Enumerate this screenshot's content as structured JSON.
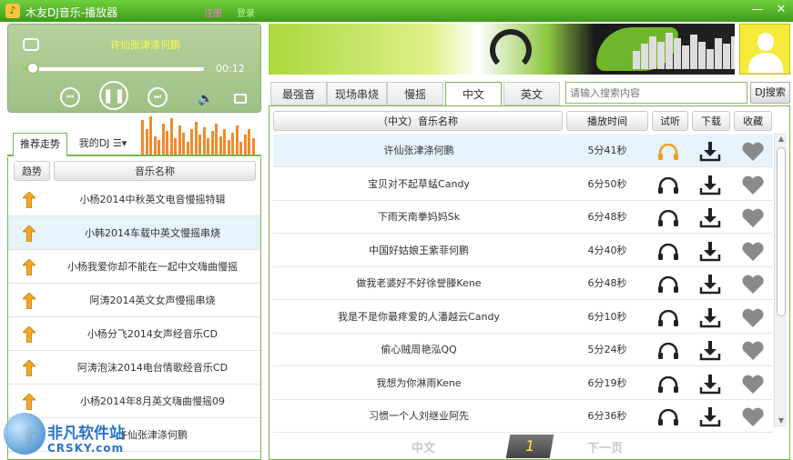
{
  "window": {
    "title": "木友DJ音乐-播放器",
    "register_link": "注册",
    "login_link": "登录",
    "minimize_glyph": "—",
    "close_glyph": "✕"
  },
  "player": {
    "now_playing": "许仙张津涤何鹏",
    "elapsed": "00:12",
    "progress": 0.04,
    "icons": [
      "repeat-icon",
      "previous-icon",
      "pause-icon",
      "next-icon",
      "volume-icon",
      "folder-icon"
    ],
    "prev_glyph": "⏮",
    "pause_glyph": "❚❚",
    "next_glyph": "⏭",
    "volume_glyph": "🔈"
  },
  "left_panel": {
    "tabs": [
      "推荐走势",
      "我的DJ ☰▾"
    ],
    "active_tab": 0,
    "headers": {
      "trend": "趋势",
      "name": "音乐名称"
    },
    "rows": [
      "小杨2014中秋英文电音慢摇特辑",
      "小韩2014车载中英文慢摇串烧",
      "小杨我爱你却不能在一起中文嗨曲慢摇",
      "阿涛2014英文女声慢摇串烧",
      "小杨分飞2014女声经音乐CD",
      "阿涛泡沫2014电台情歌经音乐CD",
      "小杨2014年8月英文嗨曲慢摇09",
      "许仙张津涤何鹏"
    ],
    "selected_row": 1
  },
  "right_panel": {
    "tabs": [
      "最强音",
      "现场串烧",
      "慢摇",
      "中文",
      "英文"
    ],
    "active_tab": 3,
    "search": {
      "placeholder": "请输入搜索内容",
      "button": "DJ搜索"
    },
    "headers": {
      "name": "（中文）音乐名称",
      "duration": "播放时间",
      "listen": "试听",
      "download": "下载",
      "favorite": "收藏"
    },
    "rows": [
      {
        "name": "许仙张津涤何鹏",
        "duration": "5分41秒"
      },
      {
        "name": "宝贝对不起草蜢Candy",
        "duration": "6分50秒"
      },
      {
        "name": "下雨天南拳妈妈Sk",
        "duration": "6分48秒"
      },
      {
        "name": "中国好姑娘王紫菲何鹏",
        "duration": "4分40秒"
      },
      {
        "name": "做我老婆好不好徐誉滕Kene",
        "duration": "6分48秒"
      },
      {
        "name": "我是不是你最疼爱的人潘越云Candy",
        "duration": "6分10秒"
      },
      {
        "name": "偷心贼周艳泓QQ",
        "duration": "5分24秒"
      },
      {
        "name": "我想为你淋雨Kene",
        "duration": "6分19秒"
      },
      {
        "name": "习惯一个人刘继业阿先",
        "duration": "6分36秒"
      }
    ],
    "selected_row": 0,
    "row_icons": [
      "headphones-icon",
      "download-icon",
      "heart-icon"
    ],
    "colors": {
      "headphones_active": "#f0a020",
      "headphones": "#222222",
      "download": "#222222",
      "heart": "#8a8a8a"
    },
    "scrollbar": {
      "up_glyph": "▲",
      "down_glyph": "▼"
    }
  },
  "pager": {
    "prev": "中文",
    "current": "1",
    "next": "下一页"
  },
  "watermark": {
    "text_cn": "非凡软件站",
    "text_en": "CRSKY.com"
  },
  "theme": {
    "accent": "#74b848",
    "title_bar": "#4aad22",
    "selection": "#e6f3fb",
    "spectrum": "#f18a2a"
  }
}
